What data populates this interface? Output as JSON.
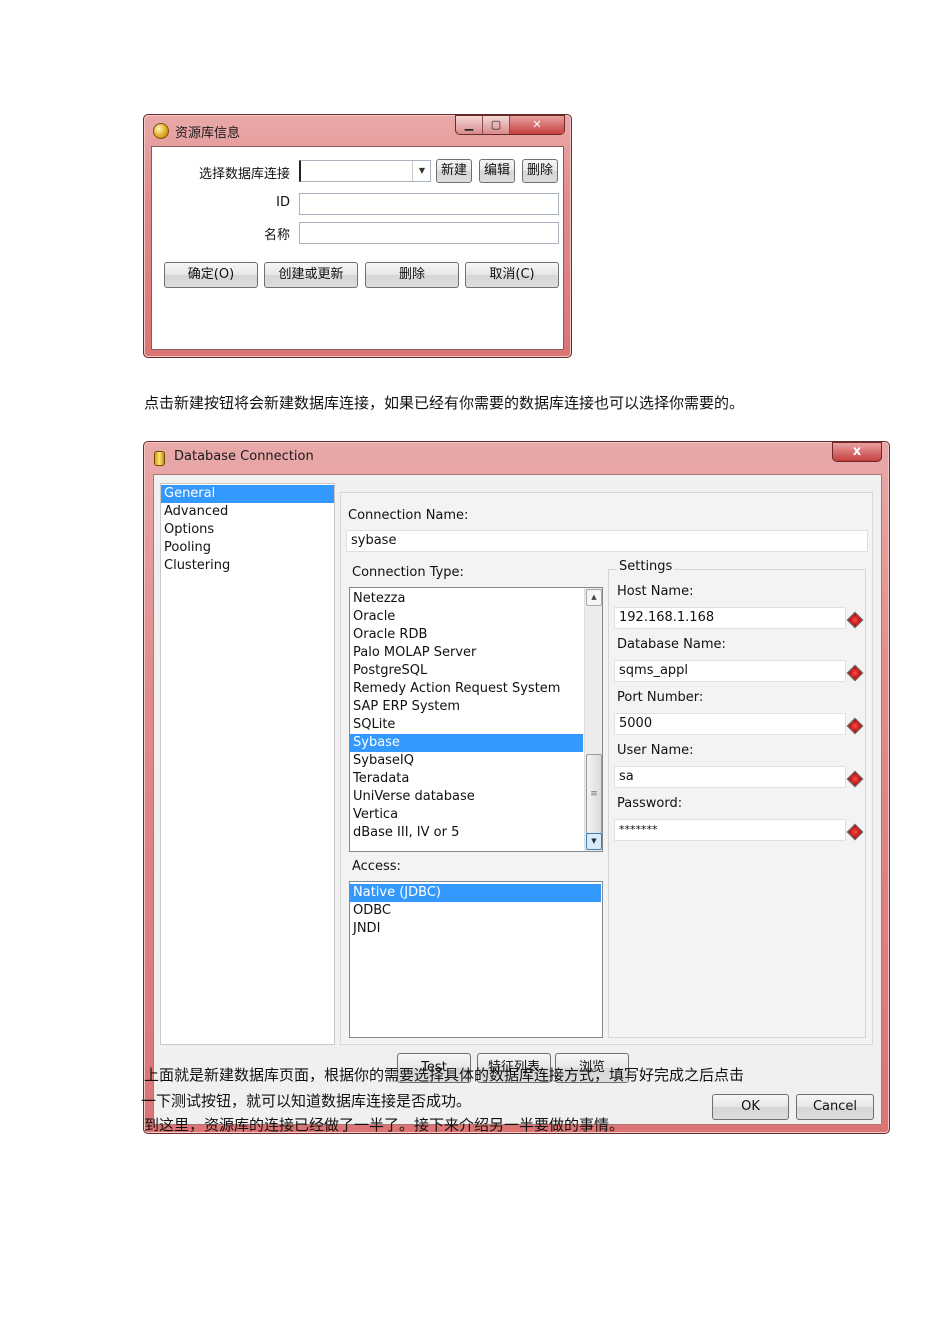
{
  "dialog1": {
    "title": "资源库信息",
    "connection_label": "选择数据库连接",
    "connection_value": "",
    "new_button": "新建",
    "edit_button": "编辑",
    "delete_button": "删除",
    "id_label": "ID",
    "id_value": "",
    "name_label": "名称",
    "name_value": "",
    "ok_button": "确定(O)",
    "create_update_button": "创建或更新",
    "remove_button": "删除",
    "cancel_button": "取消(C)"
  },
  "paragraph1": "点击新建按钮将会新建数据库连接，如果已经有你需要的数据库连接也可以选择你需要的。",
  "dialog2": {
    "title": "Database Connection",
    "close_glyph": "x",
    "nav": [
      "General",
      "Advanced",
      "Options",
      "Pooling",
      "Clustering"
    ],
    "nav_selected": "General",
    "connection_name_label": "Connection Name:",
    "connection_name_value": "sybase",
    "connection_type_label": "Connection Type:",
    "connection_types": [
      "Netezza",
      "Oracle",
      "Oracle RDB",
      "Palo MOLAP Server",
      "PostgreSQL",
      "Remedy Action Request System",
      "SAP ERP System",
      "SQLite",
      "Sybase",
      "SybaseIQ",
      "Teradata",
      "UniVerse database",
      "Vertica",
      "dBase III, IV or 5"
    ],
    "connection_type_selected": "Sybase",
    "access_label": "Access:",
    "access_types": [
      "Native (JDBC)",
      "ODBC",
      "JNDI"
    ],
    "access_selected": "Native (JDBC)",
    "settings_label": "Settings",
    "host_label": "Host Name:",
    "host_value": "192.168.1.168",
    "database_label": "Database Name:",
    "database_value": "sqms_appl",
    "port_label": "Port Number:",
    "port_value": "5000",
    "user_label": "User Name:",
    "user_value": "sa",
    "password_label": "Password:",
    "password_value": "*******",
    "test_button": "Test",
    "feature_list_button": "特征列表",
    "browse_button": "浏览",
    "ok_button": "OK",
    "cancel_button": "Cancel"
  },
  "paragraph2": {
    "line1": "上面就是新建数据库页面，根据你的需要选择具体的数据库连接方式，填写好完成之后点击",
    "line2": "一下测试按钮，就可以知道数据库连接是否成功。",
    "line3": "到这里，资源库的连接已经做了一半了。接下来介绍另一半要做的事情。"
  }
}
